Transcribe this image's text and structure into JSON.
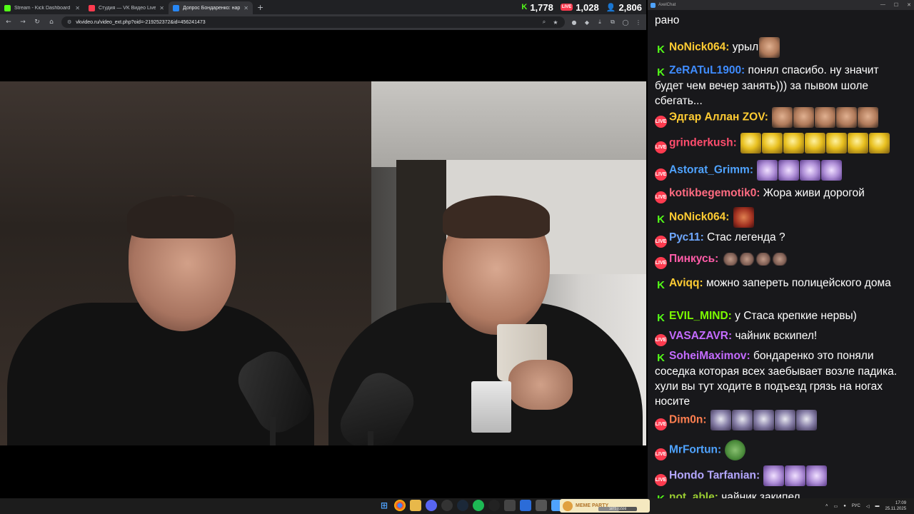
{
  "browser": {
    "tabs": [
      {
        "label": "Stream - Kick Dashboard",
        "color": "#53fc18",
        "active": false
      },
      {
        "label": "Студия — VK Видео Live",
        "color": "#ff3b4f",
        "active": false
      },
      {
        "label": "Допрос Бондаренко: нарк…",
        "color": "#2787f5",
        "active": true
      }
    ],
    "url": "vkvideo.ru/video_ext.php?oid=-219252372&id=456241473",
    "stats": {
      "kick_viewers": "1,778",
      "vk_viewers": "1,028",
      "total_viewers": "2,806"
    }
  },
  "chat": {
    "window_title": "AxelChat",
    "messages": [
      {
        "platform": "text",
        "user": "",
        "user_color": "#ffffff",
        "text": "рано",
        "emotes": []
      },
      {
        "platform": "kick",
        "user": "NoNick064:",
        "user_color": "#ffcc33",
        "text": "урыл",
        "emotes": [
          "face"
        ]
      },
      {
        "platform": "kick",
        "user": "ZeRATuL1900:",
        "user_color": "#3f8cff",
        "text": "понял спасибо. ну значит будет чем вечер занять))) за пывом шоле сбегать...",
        "emotes": []
      },
      {
        "platform": "vk",
        "user": "Эдгар Аллан ZOV:",
        "user_color": "#ffcc33",
        "text": "",
        "emotes": [
          "face",
          "face",
          "face",
          "face",
          "face"
        ]
      },
      {
        "platform": "vk",
        "user": "grinderkush:",
        "user_color": "#ff4d6d",
        "text": "",
        "emotes": [
          "coin",
          "coin",
          "coin",
          "coin",
          "coin",
          "coin",
          "coin"
        ]
      },
      {
        "platform": "vk",
        "user": "Astorat_Grimm:",
        "user_color": "#4fa3ff",
        "text": "",
        "emotes": [
          "purple",
          "purple",
          "purple",
          "purple"
        ]
      },
      {
        "platform": "vk",
        "user": "kotikbegemotik0:",
        "user_color": "#ff6b81",
        "text": "Жора живи дорогой",
        "emotes": []
      },
      {
        "platform": "kick",
        "user": "NoNick064:",
        "user_color": "#ffcc33",
        "text": "",
        "emotes": [
          "angry"
        ]
      },
      {
        "platform": "vk",
        "user": "Рус11:",
        "user_color": "#6fa8ff",
        "text": "Стас легенда ?",
        "emotes": []
      },
      {
        "platform": "vk",
        "user": "Пинкусь:",
        "user_color": "#ff5ca8",
        "text": "",
        "emotes": [
          "hand",
          "hand",
          "hand",
          "hand"
        ]
      },
      {
        "platform": "kick",
        "user": "Aviqq:",
        "user_color": "#ffcc33",
        "text": "можно запереть полицейского дома",
        "emotes": []
      },
      {
        "platform": "kick",
        "user": "EVIL_MIND:",
        "user_color": "#7cfc00",
        "text": "у Стаса крепкие нервы)",
        "emotes": []
      },
      {
        "platform": "vk",
        "user": "VASAZAVR:",
        "user_color": "#c46bff",
        "text": "чайник вскипел!",
        "emotes": []
      },
      {
        "platform": "kick",
        "user": "SoheiMaximov:",
        "user_color": "#c46bff",
        "text": "бондаренко это поняли соседка которая всех заебывает возле падика. хули вы тут ходите в подъезд грязь на ногах носите",
        "emotes": []
      },
      {
        "platform": "vk",
        "user": "Dim0n:",
        "user_color": "#ff7f50",
        "text": "",
        "emotes": [
          "owl",
          "owl",
          "owl",
          "owl",
          "owl"
        ]
      },
      {
        "platform": "vk",
        "user": "MrFortun:",
        "user_color": "#4fa3ff",
        "text": "",
        "emotes": [
          "pepe"
        ]
      },
      {
        "platform": "vk",
        "user": "Hondo Tarfanian:",
        "user_color": "#b4a7ff",
        "text": "",
        "emotes": [
          "purple",
          "purple",
          "purple"
        ]
      },
      {
        "platform": "kick",
        "user": "not_able:",
        "user_color": "#9acd32",
        "text": "чайник закипел",
        "emotes": []
      }
    ]
  },
  "taskbar": {
    "widget_label": "MEME PARTY",
    "widget_progress": "1875 / 3500",
    "widget_fraction": 0.536,
    "language": "РУС",
    "time": "17:09",
    "date": "25.11.2025"
  }
}
